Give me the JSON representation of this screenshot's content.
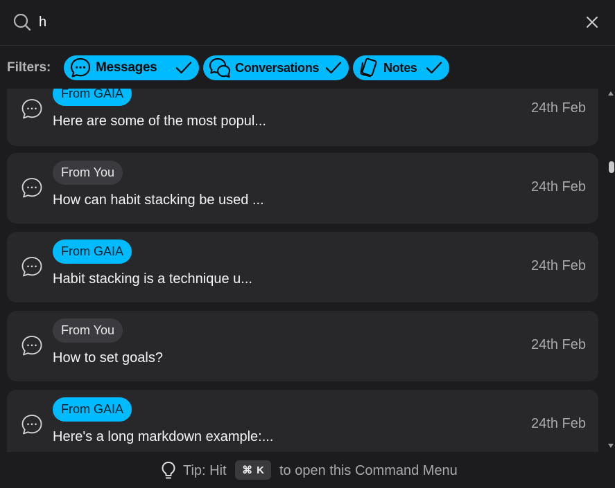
{
  "search": {
    "value": "h",
    "placeholder": ""
  },
  "filters": {
    "label": "Filters:",
    "chips": [
      {
        "label": "Messages",
        "icon": "chat-bubble-icon",
        "checked": true
      },
      {
        "label": "Conversations",
        "icon": "conversations-icon",
        "checked": true
      },
      {
        "label": "Notes",
        "icon": "notes-icon",
        "checked": true
      }
    ]
  },
  "results": [
    {
      "sender": "From GAIA",
      "text": "Here are some of the most popul...",
      "date": "24th Feb"
    },
    {
      "sender": "From You",
      "text": "How can habit stacking be used ...",
      "date": "24th Feb"
    },
    {
      "sender": "From GAIA",
      "text": "Habit stacking is a technique u...",
      "date": "24th Feb"
    },
    {
      "sender": "From You",
      "text": "How to set goals?",
      "date": "24th Feb"
    },
    {
      "sender": "From GAIA",
      "text": "Here's a long markdown example:...",
      "date": "24th Feb"
    }
  ],
  "footer": {
    "tip_label": "Tip: Hit",
    "shortcut_symbol": "⌘",
    "shortcut_key": "K",
    "tip_rest": "to open this Command Menu"
  },
  "colors": {
    "accent": "#00bbff",
    "background": "#1c1c1e",
    "card": "#28282b",
    "badge_you": "#3b3b3f"
  }
}
